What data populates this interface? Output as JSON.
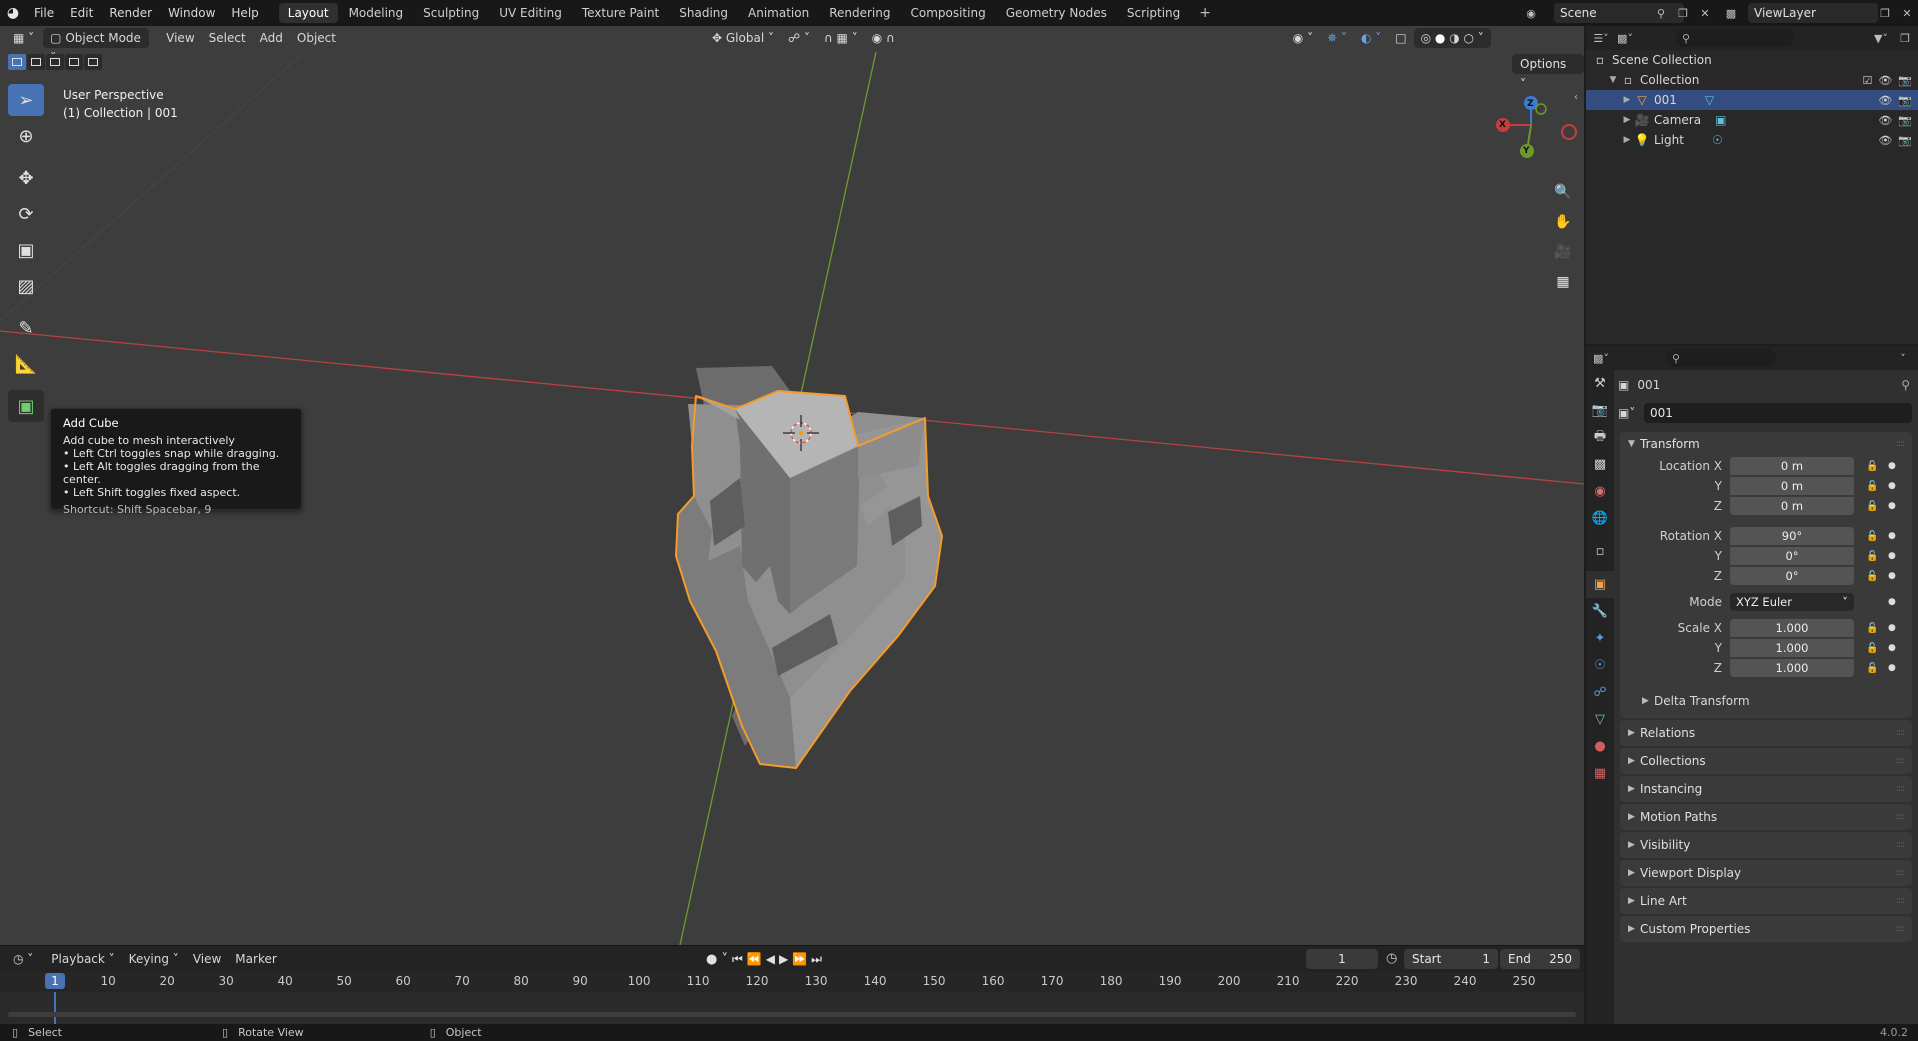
{
  "menu": {
    "items": [
      "File",
      "Edit",
      "Render",
      "Window",
      "Help"
    ]
  },
  "workspaces": [
    "Layout",
    "Modeling",
    "Sculpting",
    "UV Editing",
    "Texture Paint",
    "Shading",
    "Animation",
    "Rendering",
    "Compositing",
    "Geometry Nodes",
    "Scripting"
  ],
  "active_workspace": "Layout",
  "scene": {
    "name": "Scene",
    "view_layer": "ViewLayer"
  },
  "viewport": {
    "mode": "Object Mode",
    "menus": [
      "View",
      "Select",
      "Add",
      "Object"
    ],
    "transform_orientation": "Global",
    "options_label": "Options",
    "info_line1": "User Perspective",
    "info_line2": "(1) Collection | 001",
    "axis_labels": {
      "x": "X",
      "y": "Y",
      "z": "Z"
    }
  },
  "tooltip": {
    "title": "Add Cube",
    "description": "Add cube to mesh interactively",
    "lines": [
      "• Left Ctrl toggles snap while dragging.",
      "• Left Alt toggles dragging from the center.",
      "• Left Shift toggles fixed aspect."
    ],
    "shortcut": "Shortcut: Shift Spacebar, 9"
  },
  "timeline": {
    "menus": [
      "Playback",
      "Keying",
      "View",
      "Marker"
    ],
    "current_frame": "1",
    "start_label": "Start",
    "start": "1",
    "end_label": "End",
    "end": "250",
    "ticks": [
      "10",
      "20",
      "30",
      "40",
      "50",
      "60",
      "70",
      "80",
      "90",
      "100",
      "110",
      "120",
      "130",
      "140",
      "150",
      "160",
      "170",
      "180",
      "190",
      "200",
      "210",
      "220",
      "230",
      "240",
      "250"
    ],
    "playhead": "1"
  },
  "statusbar": {
    "select": "Select",
    "rotate": "Rotate View",
    "object": "Object",
    "version": "4.0.2"
  },
  "outliner": {
    "root": "Scene Collection",
    "collection": "Collection",
    "items": [
      {
        "name": "001",
        "type": "mesh",
        "selected": true
      },
      {
        "name": "Camera",
        "type": "camera",
        "selected": false
      },
      {
        "name": "Light",
        "type": "light",
        "selected": false
      }
    ]
  },
  "properties": {
    "object_name": "001",
    "data_name": "001",
    "transform": {
      "title": "Transform",
      "location_label": "Location X",
      "rotation_label": "Rotation X",
      "scale_label": "Scale X",
      "y_label": "Y",
      "z_label": "Z",
      "location": [
        "0 m",
        "0 m",
        "0 m"
      ],
      "rotation": [
        "90°",
        "0°",
        "0°"
      ],
      "mode_label": "Mode",
      "mode": "XYZ Euler",
      "scale": [
        "1.000",
        "1.000",
        "1.000"
      ],
      "delta": "Delta Transform"
    },
    "panels": [
      "Relations",
      "Collections",
      "Instancing",
      "Motion Paths",
      "Visibility",
      "Viewport Display",
      "Line Art",
      "Custom Properties"
    ]
  },
  "colors": {
    "accent": "#4772b3",
    "selection_outline": "#f39c2b",
    "x_axis": "#c93c3c",
    "y_axis": "#6b9c2b",
    "z_axis": "#3b7bd1"
  }
}
